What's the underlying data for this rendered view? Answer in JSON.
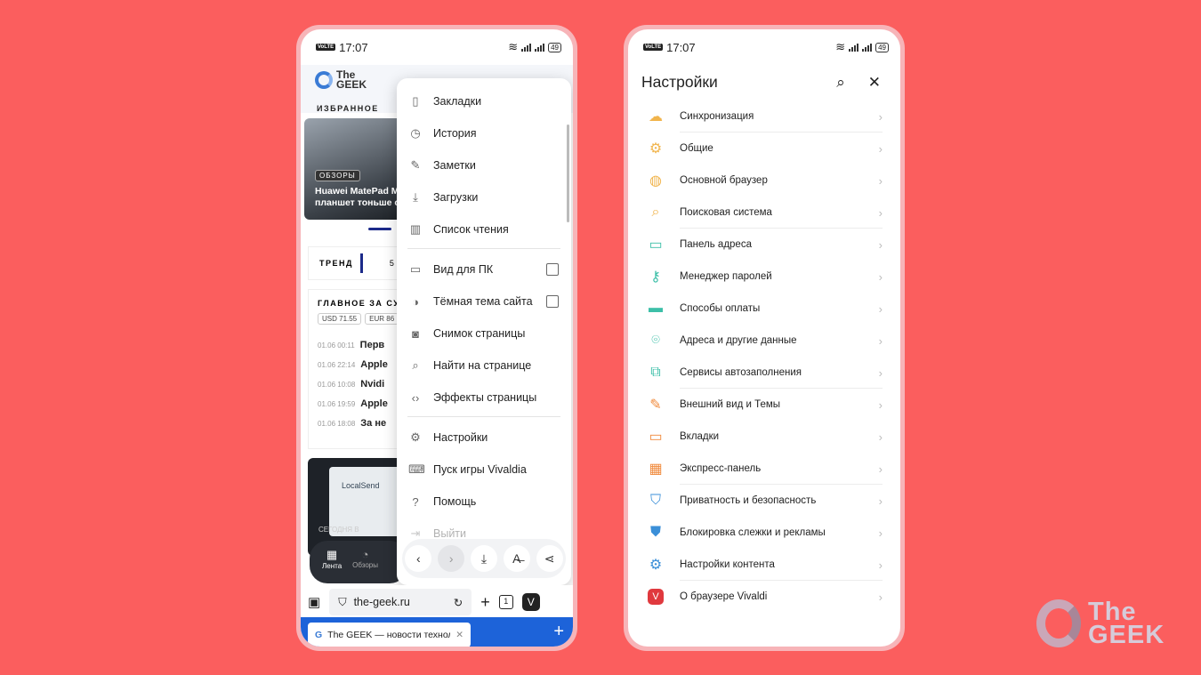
{
  "left_phone": {
    "status": {
      "time": "17:07",
      "volte": "VoLTE",
      "battery": "49"
    },
    "site": {
      "logo_line1": "The",
      "logo_line2": "GEEK",
      "favorites_label": "ИЗБРАННОЕ",
      "hero_tag": "ОБЗОРЫ",
      "hero_title_line1": "Huawei MatePad M",
      "hero_title_line2": "планшет тоньше с",
      "trend_label": "ТРЕНД",
      "trend_number": "5",
      "main_day_label": "ГЛАВНОЕ ЗА СУТК",
      "rates": [
        "USD 71.55",
        "EUR 86"
      ],
      "news": [
        {
          "time": "01.06 00:11",
          "title": "Перв"
        },
        {
          "time": "01.06 22:14",
          "title": "Apple"
        },
        {
          "time": "01.06 10:08",
          "title": "Nvidi"
        },
        {
          "time": "01.06 19:59",
          "title": "Apple"
        },
        {
          "time": "01.06 18:08",
          "title": "За не"
        }
      ],
      "promo_app": "LocalSend",
      "promo_caption": "СЕГОДНЯ В",
      "bottom_nav": [
        {
          "label": "Лента",
          "icon": "grid-icon"
        },
        {
          "label": "Обзоры",
          "icon": "compass-icon"
        }
      ]
    },
    "menu": {
      "items": [
        {
          "label": "Закладки",
          "icon": "bookmark-icon"
        },
        {
          "label": "История",
          "icon": "clock-icon"
        },
        {
          "label": "Заметки",
          "icon": "note-icon"
        },
        {
          "label": "Загрузки",
          "icon": "download-icon"
        },
        {
          "label": "Список чтения",
          "icon": "book-icon"
        },
        {
          "label": "Вид для ПК",
          "icon": "monitor-icon"
        },
        {
          "label": "Тёмная тема сайта",
          "icon": "contrast-icon"
        },
        {
          "label": "Снимок страницы",
          "icon": "camera-icon"
        },
        {
          "label": "Найти на странице",
          "icon": "find-in-page-icon"
        },
        {
          "label": "Эффекты страницы",
          "icon": "code-icon"
        },
        {
          "label": "Настройки",
          "icon": "gear-icon"
        },
        {
          "label": "Пуск игры Vivaldia",
          "icon": "gamepad-icon"
        },
        {
          "label": "Помощь",
          "icon": "help-icon"
        },
        {
          "label": "Выйти",
          "icon": "exit-icon"
        }
      ],
      "checkboxes": {
        "desktop_view": false,
        "dark_theme": false
      }
    },
    "toolbar": {
      "url": "the-geek.ru",
      "tabs_count": "1"
    },
    "tab": {
      "title": "The GEEK — новости технол",
      "favicon": "G"
    }
  },
  "right_phone": {
    "status": {
      "time": "17:07",
      "volte": "VoLTE",
      "battery": "49"
    },
    "title": "Настройки",
    "items": [
      {
        "label": "Синхронизация",
        "icon": "cloud-icon",
        "color": "#f1b44c"
      },
      {
        "label": "Общие",
        "icon": "gear-icon",
        "color": "#f1b44c"
      },
      {
        "label": "Основной браузер",
        "icon": "globe-icon",
        "color": "#f1b44c"
      },
      {
        "label": "Поисковая система",
        "icon": "search-icon",
        "color": "#f1b44c"
      },
      {
        "label": "Панель адреса",
        "icon": "address-bar-icon",
        "color": "#3dbfa8"
      },
      {
        "label": "Менеджер паролей",
        "icon": "key-icon",
        "color": "#3dbfa8"
      },
      {
        "label": "Способы оплаты",
        "icon": "card-icon",
        "color": "#3dbfa8"
      },
      {
        "label": "Адреса и другие данные",
        "icon": "location-icon",
        "color": "#3dbfa8"
      },
      {
        "label": "Сервисы автозаполнения",
        "icon": "autofill-icon",
        "color": "#3dbfa8"
      },
      {
        "label": "Внешний вид и Темы",
        "icon": "brush-icon",
        "color": "#f08a3c"
      },
      {
        "label": "Вкладки",
        "icon": "tabs-icon",
        "color": "#f08a3c"
      },
      {
        "label": "Экспресс-панель",
        "icon": "speed-dial-icon",
        "color": "#f08a3c"
      },
      {
        "label": "Приватность и безопасность",
        "icon": "shield-check-icon",
        "color": "#3b8fd8"
      },
      {
        "label": "Блокировка слежки и рекламы",
        "icon": "shield-icon",
        "color": "#3b8fd8"
      },
      {
        "label": "Настройки контента",
        "icon": "content-settings-icon",
        "color": "#3b8fd8"
      },
      {
        "label": "О браузере Vivaldi",
        "icon": "vivaldi-icon",
        "color": "#e0393e"
      }
    ]
  },
  "watermark": {
    "line1": "The",
    "line2": "GEEK"
  }
}
